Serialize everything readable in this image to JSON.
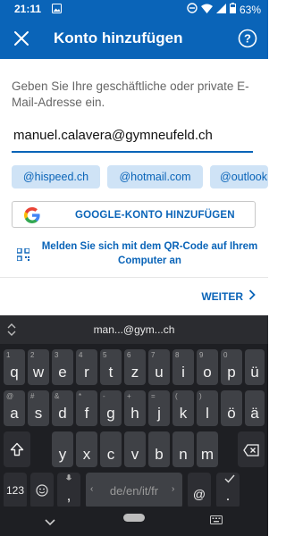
{
  "status": {
    "time": "21:11",
    "battery": "63%"
  },
  "appbar": {
    "title": "Konto hinzufügen"
  },
  "form": {
    "instructions": "Geben Sie Ihre geschäftliche oder private E-Mail-Adresse ein.",
    "email_value": "manuel.calavera@gymneufeld.ch"
  },
  "chips": [
    "@hispeed.ch",
    "@hotmail.com",
    "@outlook"
  ],
  "google_button": "GOOGLE-KONTO HINZUFÜGEN",
  "qr_link": "Melden Sie sich mit dem QR-Code auf Ihrem Computer an",
  "next_button": "WEITER",
  "keyboard": {
    "suggestion": "man...@gym...ch",
    "row1": [
      [
        "q",
        "1"
      ],
      [
        "w",
        "2"
      ],
      [
        "e",
        "3"
      ],
      [
        "r",
        "4"
      ],
      [
        "t",
        "5"
      ],
      [
        "z",
        "6"
      ],
      [
        "u",
        "7"
      ],
      [
        "i",
        "8"
      ],
      [
        "o",
        "9"
      ],
      [
        "p",
        "0"
      ],
      [
        "ü",
        ""
      ]
    ],
    "row2": [
      [
        "a",
        "@"
      ],
      [
        "s",
        "#"
      ],
      [
        "d",
        "&"
      ],
      [
        "f",
        "*"
      ],
      [
        "g",
        "-"
      ],
      [
        "h",
        "+"
      ],
      [
        "j",
        "="
      ],
      [
        "k",
        "("
      ],
      [
        "l",
        ")"
      ],
      [
        "ö",
        ""
      ],
      [
        "ä",
        ""
      ]
    ],
    "row3": [
      "y",
      "x",
      "c",
      "v",
      "b",
      "n",
      "m"
    ],
    "numbers_key": "123",
    "comma": ",",
    "space_label": "de/en/it/fr",
    "at": "@",
    "period": "."
  }
}
